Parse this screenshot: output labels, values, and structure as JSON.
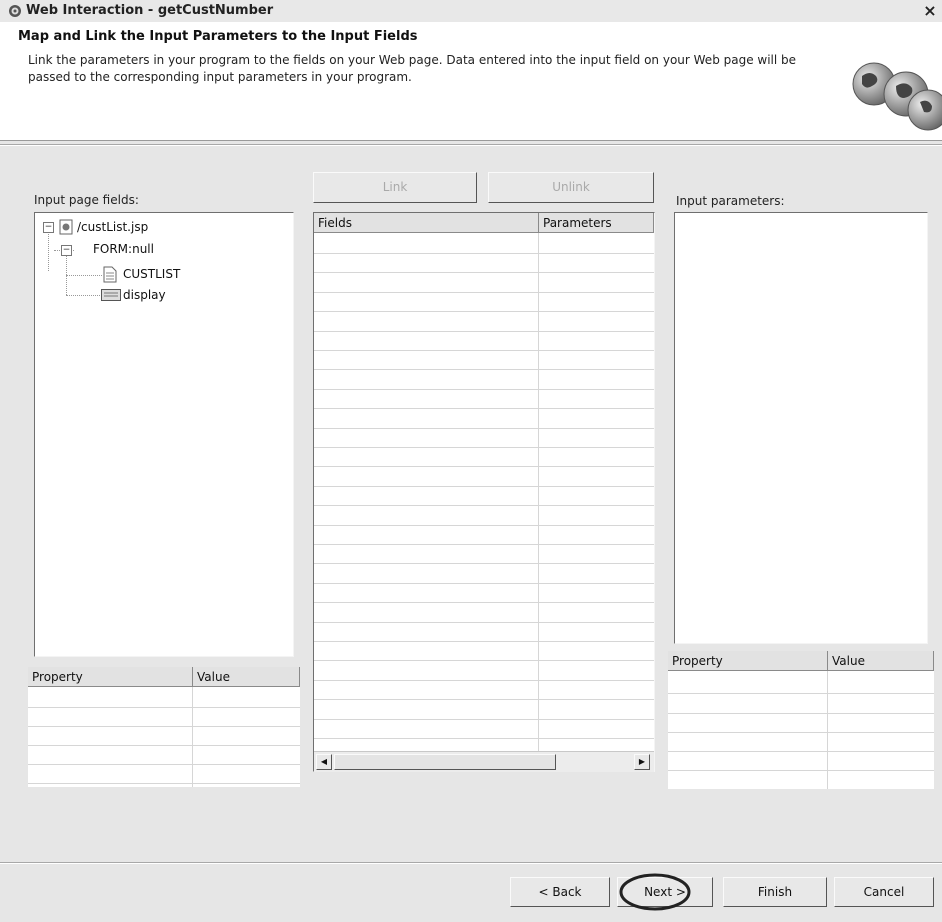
{
  "window": {
    "title": "Web Interaction - getCustNumber",
    "close_glyph": "×"
  },
  "header": {
    "title": "Map and Link the Input Parameters to the Input Fields",
    "description": "Link the parameters in your program to the fields on your Web page. Data entered into the input field on your Web page will be passed to the corresponding input parameters in your program.",
    "icon": "globe-icon"
  },
  "left": {
    "label": "Input page fields:",
    "tree": [
      {
        "label": "/custList.jsp",
        "icon": "jsp-file-icon"
      },
      {
        "label": "FORM:null",
        "icon": "none"
      },
      {
        "label": "CUSTLIST",
        "icon": "document-icon"
      },
      {
        "label": "display",
        "icon": "button-field-icon"
      }
    ],
    "props_headers": [
      "Property",
      "Value"
    ]
  },
  "middle": {
    "link_label": "Link",
    "unlink_label": "Unlink",
    "columns": [
      "Fields",
      "Parameters"
    ]
  },
  "right": {
    "label": "Input parameters:",
    "props_headers": [
      "Property",
      "Value"
    ]
  },
  "footer": {
    "back": "< Back",
    "next": "Next >",
    "finish": "Finish",
    "cancel": "Cancel"
  },
  "colors": {
    "highlight_ring": "#222222",
    "disabled_text": "#a9a9a9"
  }
}
